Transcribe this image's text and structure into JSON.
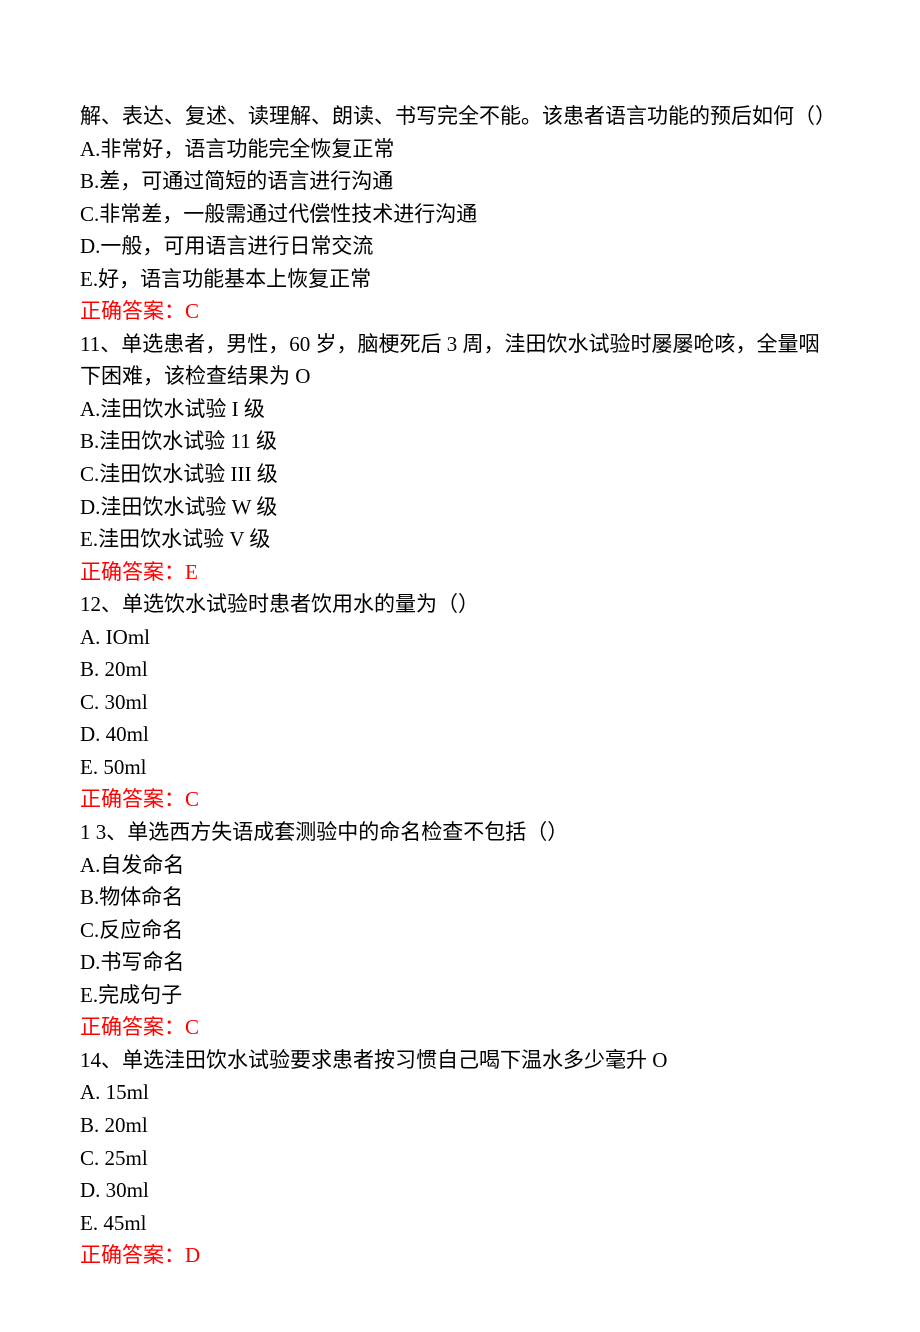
{
  "q10": {
    "stem_cont": "解、表达、复述、读理解、朗读、书写完全不能。该患者语言功能的预后如何（）",
    "options": {
      "A": "A.非常好，语言功能完全恢复正常",
      "B": "B.差，可通过简短的语言进行沟通",
      "C": "C.非常差，一般需通过代偿性技术进行沟通",
      "D": "D.一般，可用语言进行日常交流",
      "E": "E.好，语言功能基本上恢复正常"
    },
    "answer": "正确答案：C"
  },
  "q11": {
    "stem": "11、单选患者，男性，60 岁，脑梗死后 3 周，洼田饮水试验时屡屡呛咳，全量咽下困难，该检查结果为 O",
    "options": {
      "A": "A.洼田饮水试验 I 级",
      "B": "B.洼田饮水试验 11 级",
      "C": "C.洼田饮水试验 III 级",
      "D": "D.洼田饮水试验 W 级",
      "E": "E.洼田饮水试验 V 级"
    },
    "answer": "正确答案：E"
  },
  "q12": {
    "stem": "12、单选饮水试验时患者饮用水的量为（）",
    "options": {
      "A": "A. IOml",
      "B": "B. 20ml",
      "C": "C. 30ml",
      "D": "D. 40ml",
      "E": "E. 50ml"
    },
    "answer": "正确答案：C"
  },
  "q13": {
    "stem": "1 3、单选西方失语成套测验中的命名检查不包括（）",
    "options": {
      "A": "A.自发命名",
      "B": "B.物体命名",
      "C": "C.反应命名",
      "D": "D.书写命名",
      "E": "E.完成句子"
    },
    "answer": "正确答案：C"
  },
  "q14": {
    "stem": "14、单选洼田饮水试验要求患者按习惯自己喝下温水多少毫升 O",
    "options": {
      "A": "A. 15ml",
      "B": "B. 20ml",
      "C": "C. 25ml",
      "D": "D. 30ml",
      "E": "E. 45ml"
    },
    "answer": "正确答案：D"
  }
}
